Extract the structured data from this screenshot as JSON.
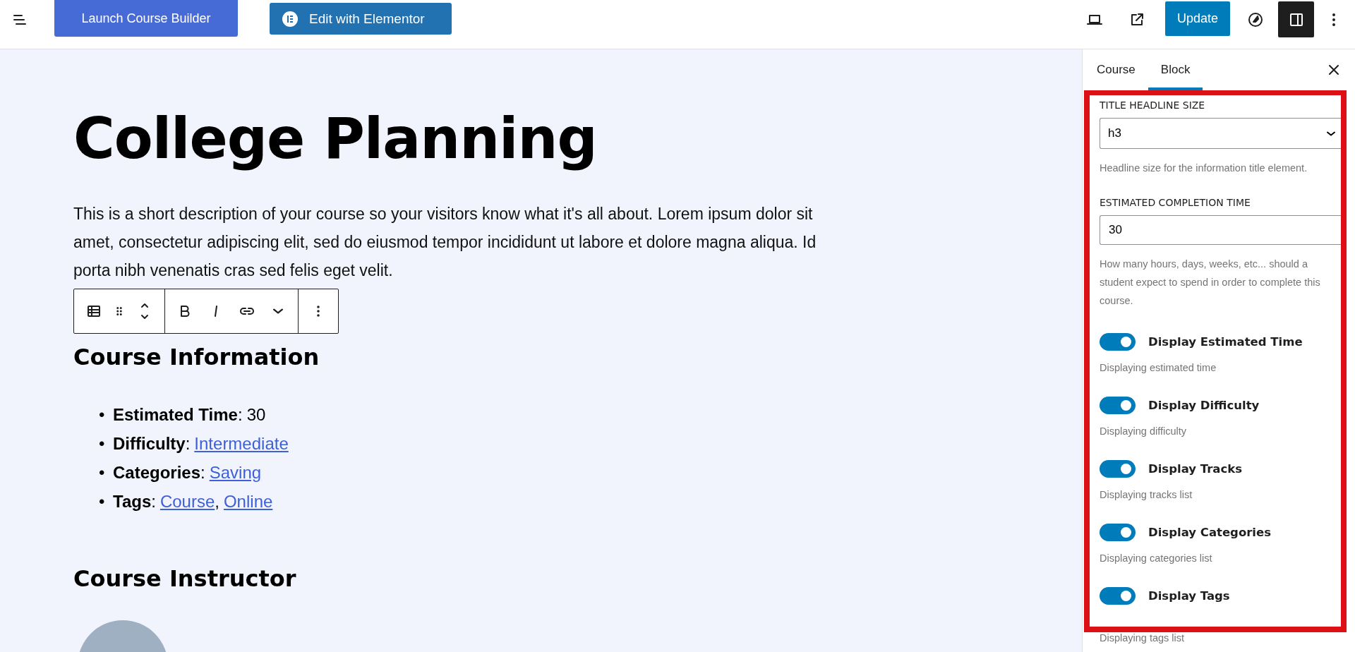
{
  "topbar": {
    "launch_button": "Launch Course Builder",
    "elementor_button": "Edit with Elementor",
    "update_button": "Update",
    "sidebar_toggle_on": true
  },
  "editor": {
    "title": "College Planning",
    "description": "This is a short description of your course so your visitors know what it's all about. Lorem ipsum dolor sit amet, consectetur adipiscing elit, sed do eiusmod tempor incididunt ut labore et dolore magna aliqua. Id porta nibh venenatis cras sed felis eget velit.",
    "info_heading": "Course Information",
    "info_items": [
      {
        "marker": "•",
        "label": "Estimated Time",
        "colon": ":",
        "values": [
          {
            "text": "30",
            "link": false
          }
        ]
      },
      {
        "marker": "•",
        "label": "Difficulty",
        "colon": ":",
        "values": [
          {
            "text": "Intermediate",
            "link": true
          }
        ]
      },
      {
        "marker": "•",
        "label": "Categories",
        "colon": ":",
        "values": [
          {
            "text": "Saving",
            "link": true
          }
        ]
      },
      {
        "marker": "•",
        "label": "Tags",
        "colon": ":",
        "values": [
          {
            "text": "Course",
            "link": true,
            "after": ","
          },
          {
            "text": "Online",
            "link": true
          }
        ]
      }
    ],
    "instructor_heading": "Course Instructor"
  },
  "sidebar": {
    "tabs": [
      {
        "label": "Course",
        "selected": false
      },
      {
        "label": "Block",
        "selected": true
      }
    ],
    "headline_size": {
      "label": "TITLE HEADLINE SIZE",
      "value": "h3",
      "help": "Headline size for the information title element."
    },
    "completion_time": {
      "label": "ESTIMATED COMPLETION TIME",
      "value": "30",
      "help": "How many hours, days, weeks, etc... should a student expect to spend in order to complete this course."
    },
    "toggles": [
      {
        "label": "Display Estimated Time",
        "help": "Displaying estimated time",
        "on": true
      },
      {
        "label": "Display Difficulty",
        "help": "Displaying difficulty",
        "on": true
      },
      {
        "label": "Display Tracks",
        "help": "Displaying tracks list",
        "on": true
      },
      {
        "label": "Display Categories",
        "help": "Displaying categories list",
        "on": true
      },
      {
        "label": "Display Tags",
        "help": "Displaying tags list",
        "on": true
      }
    ]
  }
}
